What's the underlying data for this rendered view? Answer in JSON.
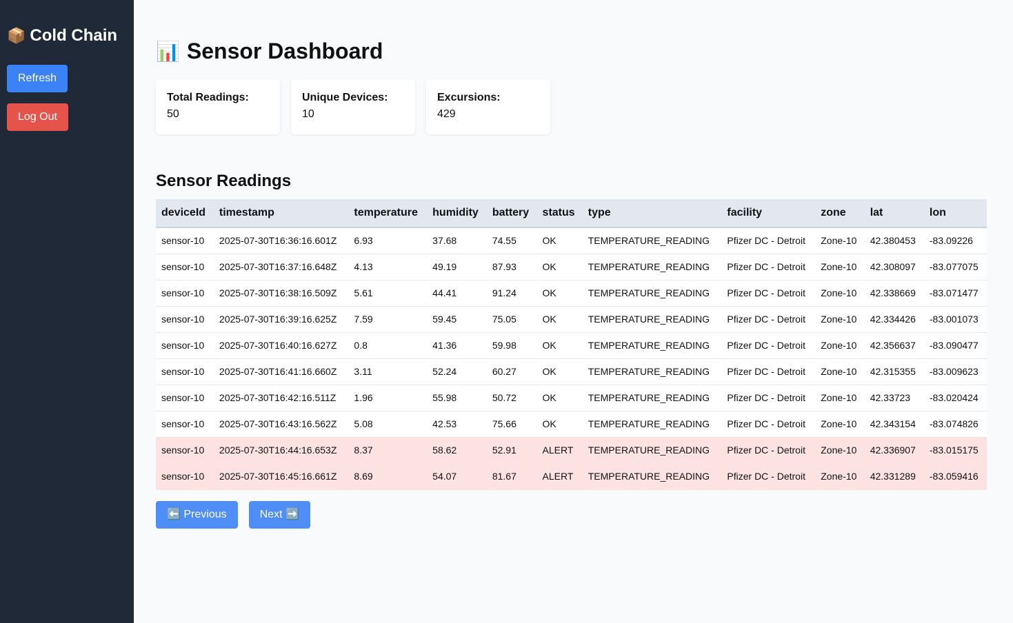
{
  "sidebar": {
    "brand_icon": "📦",
    "brand": "Cold Chain",
    "refresh_label": "Refresh",
    "logout_label": "Log Out"
  },
  "header": {
    "title_icon": "📊",
    "title": "Sensor Dashboard"
  },
  "stats": [
    {
      "label": "Total Readings:",
      "value": "50"
    },
    {
      "label": "Unique Devices:",
      "value": "10"
    },
    {
      "label": "Excursions:",
      "value": "429"
    }
  ],
  "readings": {
    "title": "Sensor Readings",
    "columns": [
      "deviceId",
      "timestamp",
      "temperature",
      "humidity",
      "battery",
      "status",
      "type",
      "facility",
      "zone",
      "lat",
      "lon"
    ],
    "rows": [
      [
        "sensor-10",
        "2025-07-30T16:36:16.601Z",
        "6.93",
        "37.68",
        "74.55",
        "OK",
        "TEMPERATURE_READING",
        "Pfizer DC - Detroit",
        "Zone-10",
        "42.380453",
        "-83.09226"
      ],
      [
        "sensor-10",
        "2025-07-30T16:37:16.648Z",
        "4.13",
        "49.19",
        "87.93",
        "OK",
        "TEMPERATURE_READING",
        "Pfizer DC - Detroit",
        "Zone-10",
        "42.308097",
        "-83.077075"
      ],
      [
        "sensor-10",
        "2025-07-30T16:38:16.509Z",
        "5.61",
        "44.41",
        "91.24",
        "OK",
        "TEMPERATURE_READING",
        "Pfizer DC - Detroit",
        "Zone-10",
        "42.338669",
        "-83.071477"
      ],
      [
        "sensor-10",
        "2025-07-30T16:39:16.625Z",
        "7.59",
        "59.45",
        "75.05",
        "OK",
        "TEMPERATURE_READING",
        "Pfizer DC - Detroit",
        "Zone-10",
        "42.334426",
        "-83.001073"
      ],
      [
        "sensor-10",
        "2025-07-30T16:40:16.627Z",
        "0.8",
        "41.36",
        "59.98",
        "OK",
        "TEMPERATURE_READING",
        "Pfizer DC - Detroit",
        "Zone-10",
        "42.356637",
        "-83.090477"
      ],
      [
        "sensor-10",
        "2025-07-30T16:41:16.660Z",
        "3.11",
        "52.24",
        "60.27",
        "OK",
        "TEMPERATURE_READING",
        "Pfizer DC - Detroit",
        "Zone-10",
        "42.315355",
        "-83.009623"
      ],
      [
        "sensor-10",
        "2025-07-30T16:42:16.511Z",
        "1.96",
        "55.98",
        "50.72",
        "OK",
        "TEMPERATURE_READING",
        "Pfizer DC - Detroit",
        "Zone-10",
        "42.33723",
        "-83.020424"
      ],
      [
        "sensor-10",
        "2025-07-30T16:43:16.562Z",
        "5.08",
        "42.53",
        "75.66",
        "OK",
        "TEMPERATURE_READING",
        "Pfizer DC - Detroit",
        "Zone-10",
        "42.343154",
        "-83.074826"
      ],
      [
        "sensor-10",
        "2025-07-30T16:44:16.653Z",
        "8.37",
        "58.62",
        "52.91",
        "ALERT",
        "TEMPERATURE_READING",
        "Pfizer DC - Detroit",
        "Zone-10",
        "42.336907",
        "-83.015175"
      ],
      [
        "sensor-10",
        "2025-07-30T16:45:16.661Z",
        "8.69",
        "54.07",
        "81.67",
        "ALERT",
        "TEMPERATURE_READING",
        "Pfizer DC - Detroit",
        "Zone-10",
        "42.331289",
        "-83.059416"
      ]
    ],
    "alert_row_color": "#fde2e2"
  },
  "pager": {
    "prev_label": "⬅️ Previous",
    "next_label": "Next ➡️"
  },
  "colors": {
    "sidebar_bg": "#1f2937",
    "primary": "#3b82f6",
    "danger": "#e5534b"
  }
}
